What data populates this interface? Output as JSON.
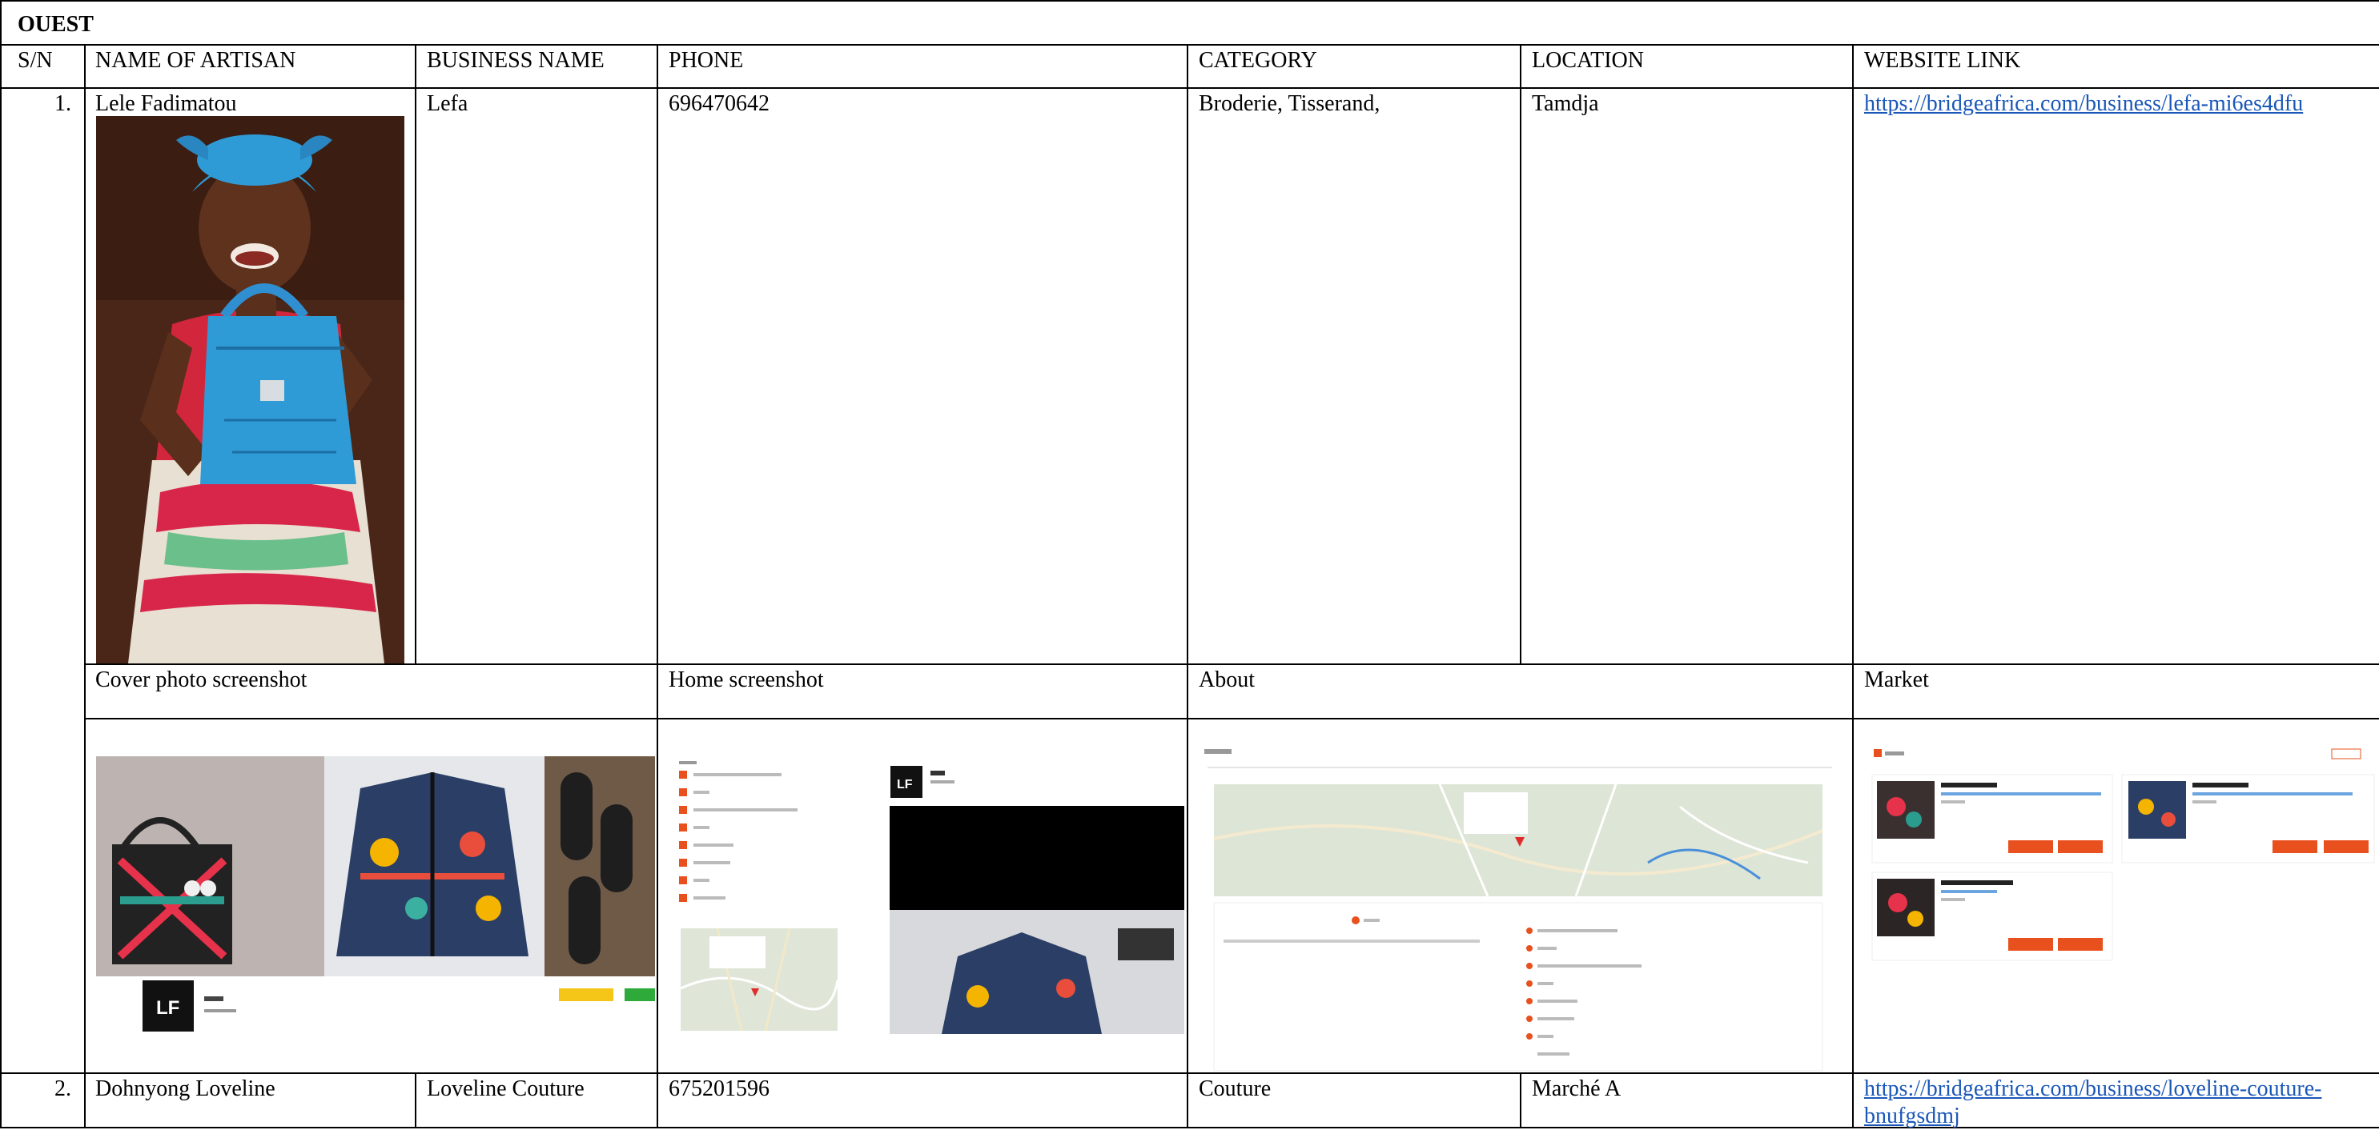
{
  "region": "OUEST",
  "headers": {
    "sn": "S/N",
    "name": "NAME OF ARTISAN",
    "business": "BUSINESS NAME",
    "phone": "PHONE",
    "category": "CATEGORY",
    "location": "LOCATION",
    "website": "WEBSITE LINK"
  },
  "rows": [
    {
      "sn": "1.",
      "name": "Lele Fadimatou",
      "business": "Lefa",
      "phone": "696470642",
      "category": "Broderie, Tisserand,",
      "location": "Tamdja",
      "website": "https://bridgeafrica.com/business/lefa-mi6es4dfu"
    },
    {
      "sn": "2.",
      "name": "Dohnyong Loveline",
      "business": "Loveline Couture",
      "phone": "675201596",
      "category": "Couture",
      "location": "Marché A",
      "website_line1": "https://bridgeafrica.com/business/loveline-couture-",
      "website_line2": "bnufgsdmj"
    }
  ],
  "screenshot_labels": {
    "cover": "Cover photo screenshot",
    "home": "Home screenshot",
    "about": "About",
    "market": "Market"
  },
  "colors": {
    "link": "#1a57b8",
    "accent_orange": "#e8501d",
    "badge_yellow": "#f5c518",
    "badge_green": "#2eaa3b"
  }
}
